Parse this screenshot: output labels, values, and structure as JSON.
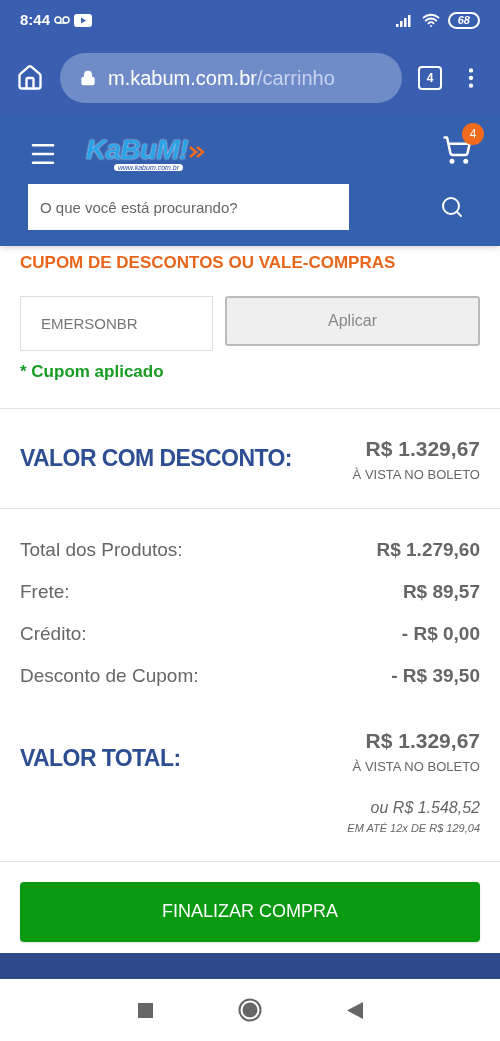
{
  "status_bar": {
    "time": "8:44",
    "battery": "68"
  },
  "browser": {
    "url_host": "m.kabum.com.br",
    "url_path": "/carrinho",
    "tab_count": "4"
  },
  "header": {
    "logo": {
      "text": "KaBuM!",
      "subtext": "www.kabum.com.br"
    },
    "cart_count": "4",
    "search": {
      "placeholder": "O que você está procurando?"
    }
  },
  "coupon": {
    "title": "CUPOM DE DESCONTOS OU VALE-COMPRAS",
    "code": "EMERSONBR",
    "apply_button": {
      "label": "Aplicar",
      "disabled": true
    },
    "message": "* Cupom aplicado"
  },
  "discount_total": {
    "label": "VALOR COM DESCONTO:",
    "amount": "R$ 1.329,67",
    "note": "À VISTA NO BOLETO"
  },
  "summary": [
    {
      "label": "Total dos Produtos:",
      "value": "R$ 1.279,60"
    },
    {
      "label": "Frete:",
      "value": "R$ 89,57"
    },
    {
      "label": "Crédito:",
      "value": "- R$ 0,00"
    },
    {
      "label": "Desconto de Cupom:",
      "value": "- R$ 39,50"
    }
  ],
  "total": {
    "label": "VALOR TOTAL:",
    "amount": "R$ 1.329,67",
    "note": "À VISTA NO BOLETO",
    "installment_total": "ou R$ 1.548,52",
    "installment_note": "EM ATÉ 12x DE R$ 129,04"
  },
  "checkout_button": "FINALIZAR COMPRA"
}
